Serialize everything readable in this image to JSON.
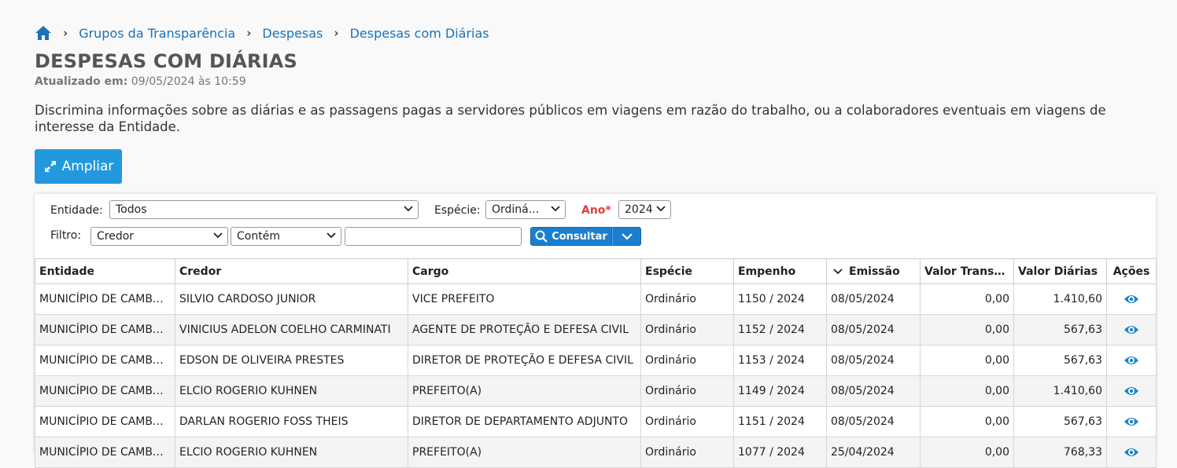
{
  "breadcrumb": {
    "items": [
      "Grupos da Transparência",
      "Despesas",
      "Despesas com Diárias"
    ]
  },
  "page": {
    "title": "DESPESAS COM DIÁRIAS",
    "updated_label": "Atualizado em:",
    "updated_value": "09/05/2024 às 10:59",
    "description": "Discrimina informações sobre as diárias e as passagens pagas a servidores públicos em viagens em razão do trabalho, ou a colaboradores eventuais em viagens de interesse da Entidade.",
    "ampliar_label": "Ampliar"
  },
  "filters": {
    "entidade_label": "Entidade:",
    "entidade_value": "Todos",
    "especie_label": "Espécie:",
    "especie_value": "Ordiná...",
    "ano_label": "Ano*",
    "ano_value": "2024",
    "filtro_label": "Filtro:",
    "filtro_field": "Credor",
    "filtro_operator": "Contém",
    "filtro_text": "",
    "consultar_label": "Consultar"
  },
  "table": {
    "headers": [
      "Entidade",
      "Credor",
      "Cargo",
      "Espécie",
      "Empenho",
      "Emissão",
      "Valor Transpo...",
      "Valor Diárias",
      "Ações"
    ],
    "rows": [
      [
        "MUNICÍPIO DE CAMBOR...",
        "SILVIO CARDOSO JUNIOR",
        "VICE PREFEITO",
        "Ordinário",
        "1150 / 2024",
        "08/05/2024",
        "0,00",
        "1.410,60"
      ],
      [
        "MUNICÍPIO DE CAMBOR...",
        "VINICIUS ADELON COELHO CARMINATI",
        "AGENTE DE PROTEÇÃO E DEFESA CIVIL",
        "Ordinário",
        "1152 / 2024",
        "08/05/2024",
        "0,00",
        "567,63"
      ],
      [
        "MUNICÍPIO DE CAMBOR...",
        "EDSON DE OLIVEIRA PRESTES",
        "DIRETOR DE PROTEÇÃO E DEFESA CIVIL",
        "Ordinário",
        "1153 / 2024",
        "08/05/2024",
        "0,00",
        "567,63"
      ],
      [
        "MUNICÍPIO DE CAMBOR...",
        "ELCIO ROGERIO KUHNEN",
        "PREFEITO(A)",
        "Ordinário",
        "1149 / 2024",
        "08/05/2024",
        "0,00",
        "1.410,60"
      ],
      [
        "MUNICÍPIO DE CAMBOR...",
        "DARLAN ROGERIO FOSS THEIS",
        "DIRETOR DE DEPARTAMENTO ADJUNTO",
        "Ordinário",
        "1151 / 2024",
        "08/05/2024",
        "0,00",
        "567,63"
      ],
      [
        "MUNICÍPIO DE CAMBOR...",
        "ELCIO ROGERIO KUHNEN",
        "PREFEITO(A)",
        "Ordinário",
        "1077 / 2024",
        "25/04/2024",
        "0,00",
        "768,33"
      ]
    ]
  },
  "colors": {
    "accent": "#2299df",
    "link": "#1a72b8",
    "required": "#e04040"
  }
}
